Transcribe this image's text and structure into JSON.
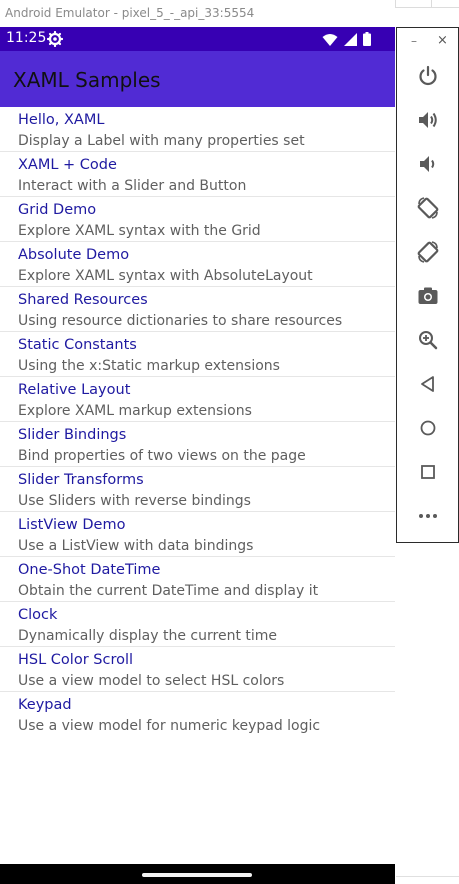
{
  "window": {
    "title": "Android Emulator - pixel_5_-_api_33:5554"
  },
  "status_bar": {
    "time": "11:25",
    "icons": [
      "settings-icon",
      "wifi-icon",
      "signal-icon",
      "battery-icon"
    ]
  },
  "app_bar": {
    "title": "XAML Samples"
  },
  "list": {
    "items": [
      {
        "title": "Hello, XAML",
        "description": "Display a Label with many properties set"
      },
      {
        "title": "XAML + Code",
        "description": "Interact with a Slider and Button"
      },
      {
        "title": "Grid Demo",
        "description": "Explore XAML syntax with the Grid"
      },
      {
        "title": "Absolute Demo",
        "description": "Explore XAML syntax with AbsoluteLayout"
      },
      {
        "title": "Shared Resources",
        "description": "Using resource dictionaries to share resources"
      },
      {
        "title": "Static Constants",
        "description": "Using the x:Static markup extensions"
      },
      {
        "title": "Relative Layout",
        "description": "Explore XAML markup extensions"
      },
      {
        "title": "Slider Bindings",
        "description": "Bind properties of two views on the page"
      },
      {
        "title": "Slider Transforms",
        "description": "Use Sliders with reverse bindings"
      },
      {
        "title": "ListView Demo",
        "description": "Use a ListView with data bindings"
      },
      {
        "title": "One-Shot DateTime",
        "description": "Obtain the current DateTime and display it"
      },
      {
        "title": "Clock",
        "description": "Dynamically display the current time"
      },
      {
        "title": "HSL Color Scroll",
        "description": "Use a view model to select HSL colors"
      },
      {
        "title": "Keypad",
        "description": "Use a view model for numeric keypad logic"
      }
    ]
  },
  "emulator_toolbar": {
    "minimize_label": "–",
    "close_label": "×",
    "buttons": [
      "power-icon",
      "volume-up-icon",
      "volume-down-icon",
      "rotate-left-icon",
      "rotate-right-icon",
      "camera-icon",
      "zoom-icon",
      "back-icon",
      "home-icon",
      "overview-icon",
      "more-icon"
    ]
  },
  "colors": {
    "status_bar": "#3700b3",
    "app_bar": "#512bd4",
    "item_title": "#1f1aa1",
    "item_desc": "#5f5f5f",
    "toolbar_icon": "#5a5a5a"
  }
}
